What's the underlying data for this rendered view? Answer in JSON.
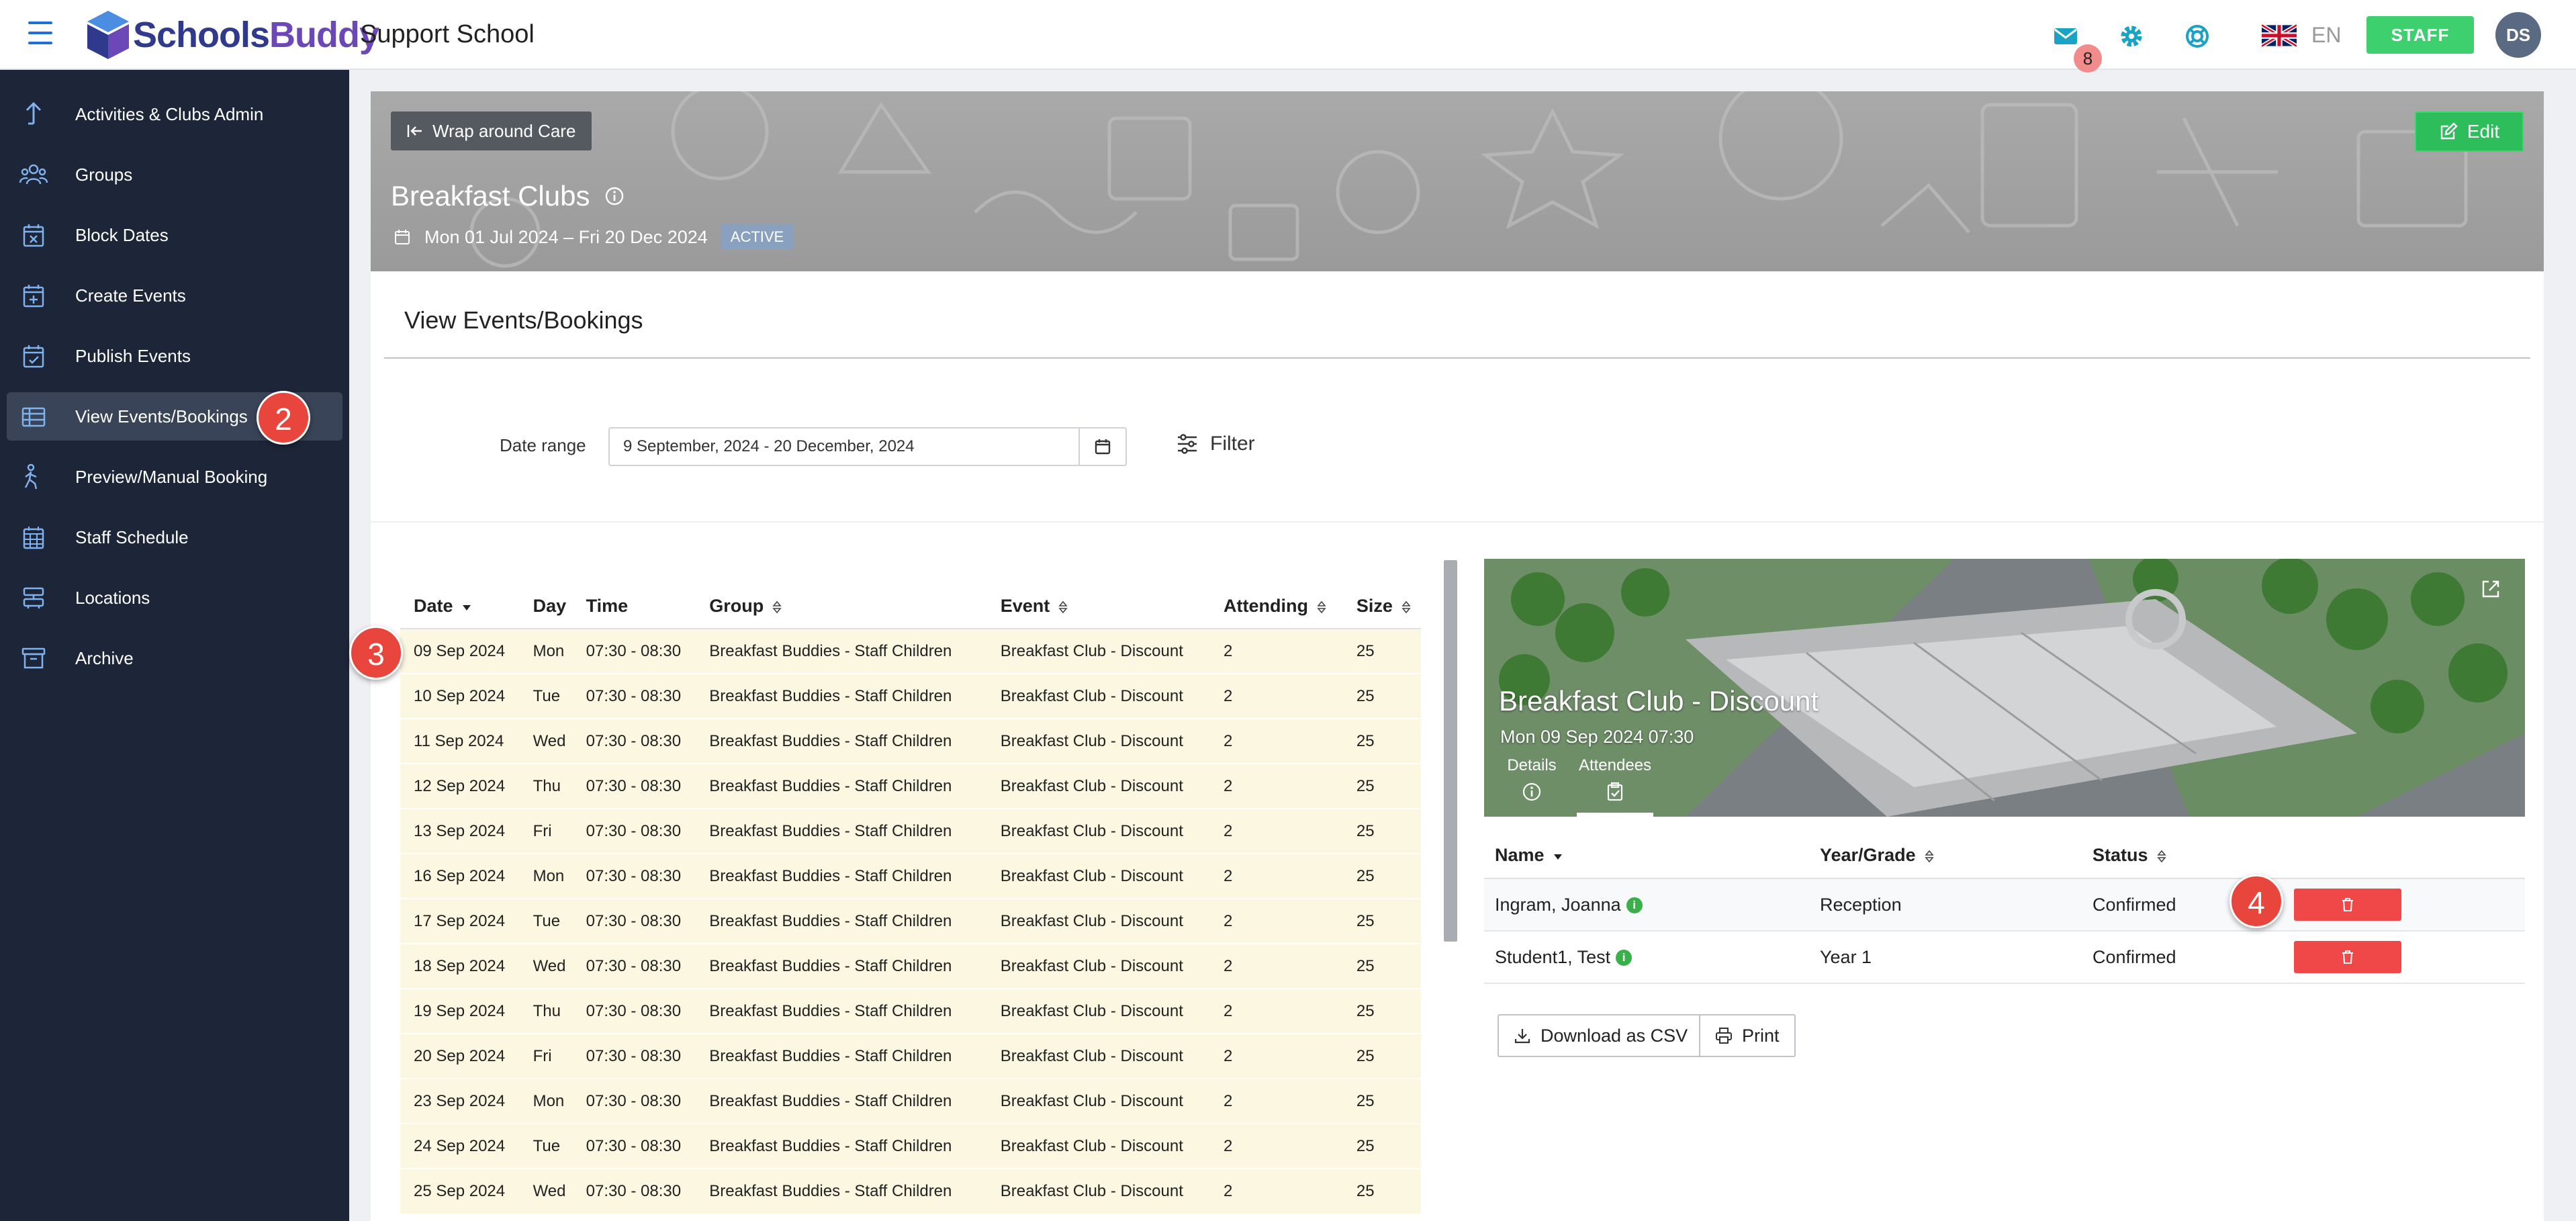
{
  "header": {
    "logo_part1": "Schools",
    "logo_part2": "Buddy",
    "school_name": "Support School",
    "mail_count": "8",
    "language": "EN",
    "role_button": "STAFF",
    "avatar_initials": "DS"
  },
  "sidebar": {
    "items": [
      {
        "label": "Activities & Clubs Admin",
        "icon": "arrow-up-icon"
      },
      {
        "label": "Groups",
        "icon": "people-icon"
      },
      {
        "label": "Block Dates",
        "icon": "calendar-x-icon"
      },
      {
        "label": "Create Events",
        "icon": "calendar-plus-icon"
      },
      {
        "label": "Publish Events",
        "icon": "calendar-check-icon"
      },
      {
        "label": "View Events/Bookings",
        "icon": "table-icon"
      },
      {
        "label": "Preview/Manual Booking",
        "icon": "person-walk-icon"
      },
      {
        "label": "Staff Schedule",
        "icon": "calendar-grid-icon"
      },
      {
        "label": "Locations",
        "icon": "layers-icon"
      },
      {
        "label": "Archive",
        "icon": "archive-icon"
      }
    ],
    "active_index": 5
  },
  "callouts": {
    "c2": "2",
    "c3": "3",
    "c4": "4"
  },
  "hero": {
    "back_label": "Wrap around Care",
    "edit_label": "Edit",
    "title": "Breakfast Clubs",
    "dates": "Mon 01 Jul 2024 – Fri 20 Dec 2024",
    "status": "ACTIVE"
  },
  "bookings": {
    "title": "View Events/Bookings",
    "date_range_label": "Date range",
    "date_range_value": "9 September, 2024 - 20 December, 2024",
    "filter_label": "Filter"
  },
  "events_table": {
    "columns": [
      "Date",
      "Day",
      "Time",
      "Group",
      "Event",
      "Attending",
      "Size"
    ],
    "rows": [
      [
        "09 Sep 2024",
        "Mon",
        "07:30 - 08:30",
        "Breakfast Buddies - Staff Children",
        "Breakfast Club - Discount",
        "2",
        "25"
      ],
      [
        "10 Sep 2024",
        "Tue",
        "07:30 - 08:30",
        "Breakfast Buddies - Staff Children",
        "Breakfast Club - Discount",
        "2",
        "25"
      ],
      [
        "11 Sep 2024",
        "Wed",
        "07:30 - 08:30",
        "Breakfast Buddies - Staff Children",
        "Breakfast Club - Discount",
        "2",
        "25"
      ],
      [
        "12 Sep 2024",
        "Thu",
        "07:30 - 08:30",
        "Breakfast Buddies - Staff Children",
        "Breakfast Club - Discount",
        "2",
        "25"
      ],
      [
        "13 Sep 2024",
        "Fri",
        "07:30 - 08:30",
        "Breakfast Buddies - Staff Children",
        "Breakfast Club - Discount",
        "2",
        "25"
      ],
      [
        "16 Sep 2024",
        "Mon",
        "07:30 - 08:30",
        "Breakfast Buddies - Staff Children",
        "Breakfast Club - Discount",
        "2",
        "25"
      ],
      [
        "17 Sep 2024",
        "Tue",
        "07:30 - 08:30",
        "Breakfast Buddies - Staff Children",
        "Breakfast Club - Discount",
        "2",
        "25"
      ],
      [
        "18 Sep 2024",
        "Wed",
        "07:30 - 08:30",
        "Breakfast Buddies - Staff Children",
        "Breakfast Club - Discount",
        "2",
        "25"
      ],
      [
        "19 Sep 2024",
        "Thu",
        "07:30 - 08:30",
        "Breakfast Buddies - Staff Children",
        "Breakfast Club - Discount",
        "2",
        "25"
      ],
      [
        "20 Sep 2024",
        "Fri",
        "07:30 - 08:30",
        "Breakfast Buddies - Staff Children",
        "Breakfast Club - Discount",
        "2",
        "25"
      ],
      [
        "23 Sep 2024",
        "Mon",
        "07:30 - 08:30",
        "Breakfast Buddies - Staff Children",
        "Breakfast Club - Discount",
        "2",
        "25"
      ],
      [
        "24 Sep 2024",
        "Tue",
        "07:30 - 08:30",
        "Breakfast Buddies - Staff Children",
        "Breakfast Club - Discount",
        "2",
        "25"
      ],
      [
        "25 Sep 2024",
        "Wed",
        "07:30 - 08:30",
        "Breakfast Buddies - Staff Children",
        "Breakfast Club - Discount",
        "2",
        "25"
      ]
    ]
  },
  "event_card": {
    "title": "Breakfast Club - Discount",
    "subtitle": "Mon 09 Sep 2024 07:30",
    "tab_details": "Details",
    "tab_attendees": "Attendees",
    "columns": [
      "Name",
      "Year/Grade",
      "Status"
    ],
    "attendees": [
      {
        "name": "Ingram, Joanna",
        "year": "Reception",
        "status": "Confirmed"
      },
      {
        "name": "Student1, Test",
        "year": "Year 1",
        "status": "Confirmed"
      }
    ],
    "download_label": "Download as CSV",
    "print_label": "Print"
  },
  "colors": {
    "sidebar_bg": "#1d2638",
    "accent_blue": "#1e6fd9",
    "staff_green": "#3ecf6f",
    "delete_red": "#f04848",
    "row_highlight": "#fbf7e1"
  }
}
